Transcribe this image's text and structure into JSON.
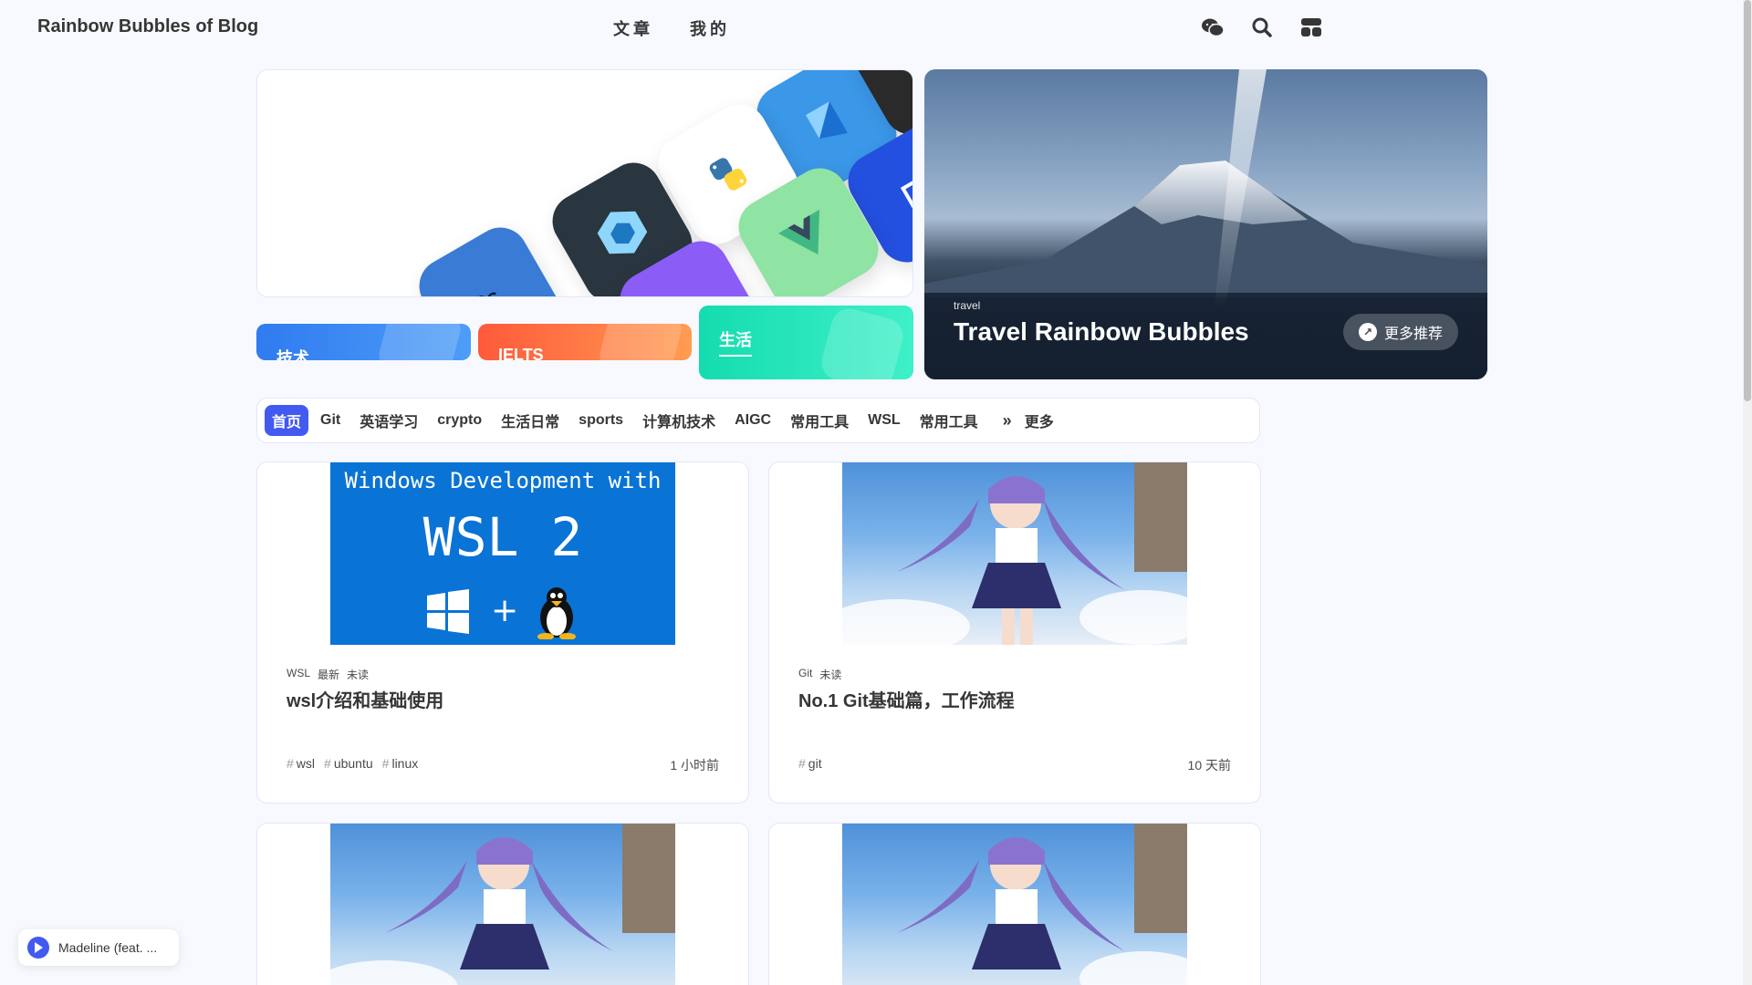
{
  "site": {
    "brand": "Rainbow Bubbles of Blog"
  },
  "nav": {
    "menu": [
      "文章",
      "我的"
    ],
    "icons": [
      "wechat-icon",
      "search-icon",
      "layout-icon"
    ]
  },
  "categories": {
    "tech": "技术",
    "ielts": "IELTS",
    "life": "生活"
  },
  "travel": {
    "tag": "travel",
    "title": "Travel Rainbow Bubbles",
    "more_label": "更多推荐"
  },
  "tabs": {
    "items": [
      "首页",
      "Git",
      "英语学习",
      "crypto",
      "生活日常",
      "sports",
      "计算机技术",
      "AIGC",
      "常用工具",
      "WSL",
      "常用工具"
    ],
    "active": "首页",
    "more_label": "更多"
  },
  "posts": [
    {
      "image_lines": [
        "Windows Development with",
        "WSL 2",
        "+"
      ],
      "meta": [
        "WSL",
        "最新",
        "未读"
      ],
      "title": "wsl介绍和基础使用",
      "tags": [
        "wsl",
        "ubuntu",
        "linux"
      ],
      "date": "1 小时前"
    },
    {
      "meta": [
        "Git",
        "未读"
      ],
      "title": "No.1 Git基础篇，工作流程",
      "tags": [
        "git"
      ],
      "date": "10 天前"
    }
  ],
  "music": {
    "track": "Madeline (feat. ..."
  },
  "colors": {
    "accent": "#425aef",
    "tech": "#3a86ff",
    "ielts": "#ff6b3b",
    "life": "#1fe0b5"
  }
}
